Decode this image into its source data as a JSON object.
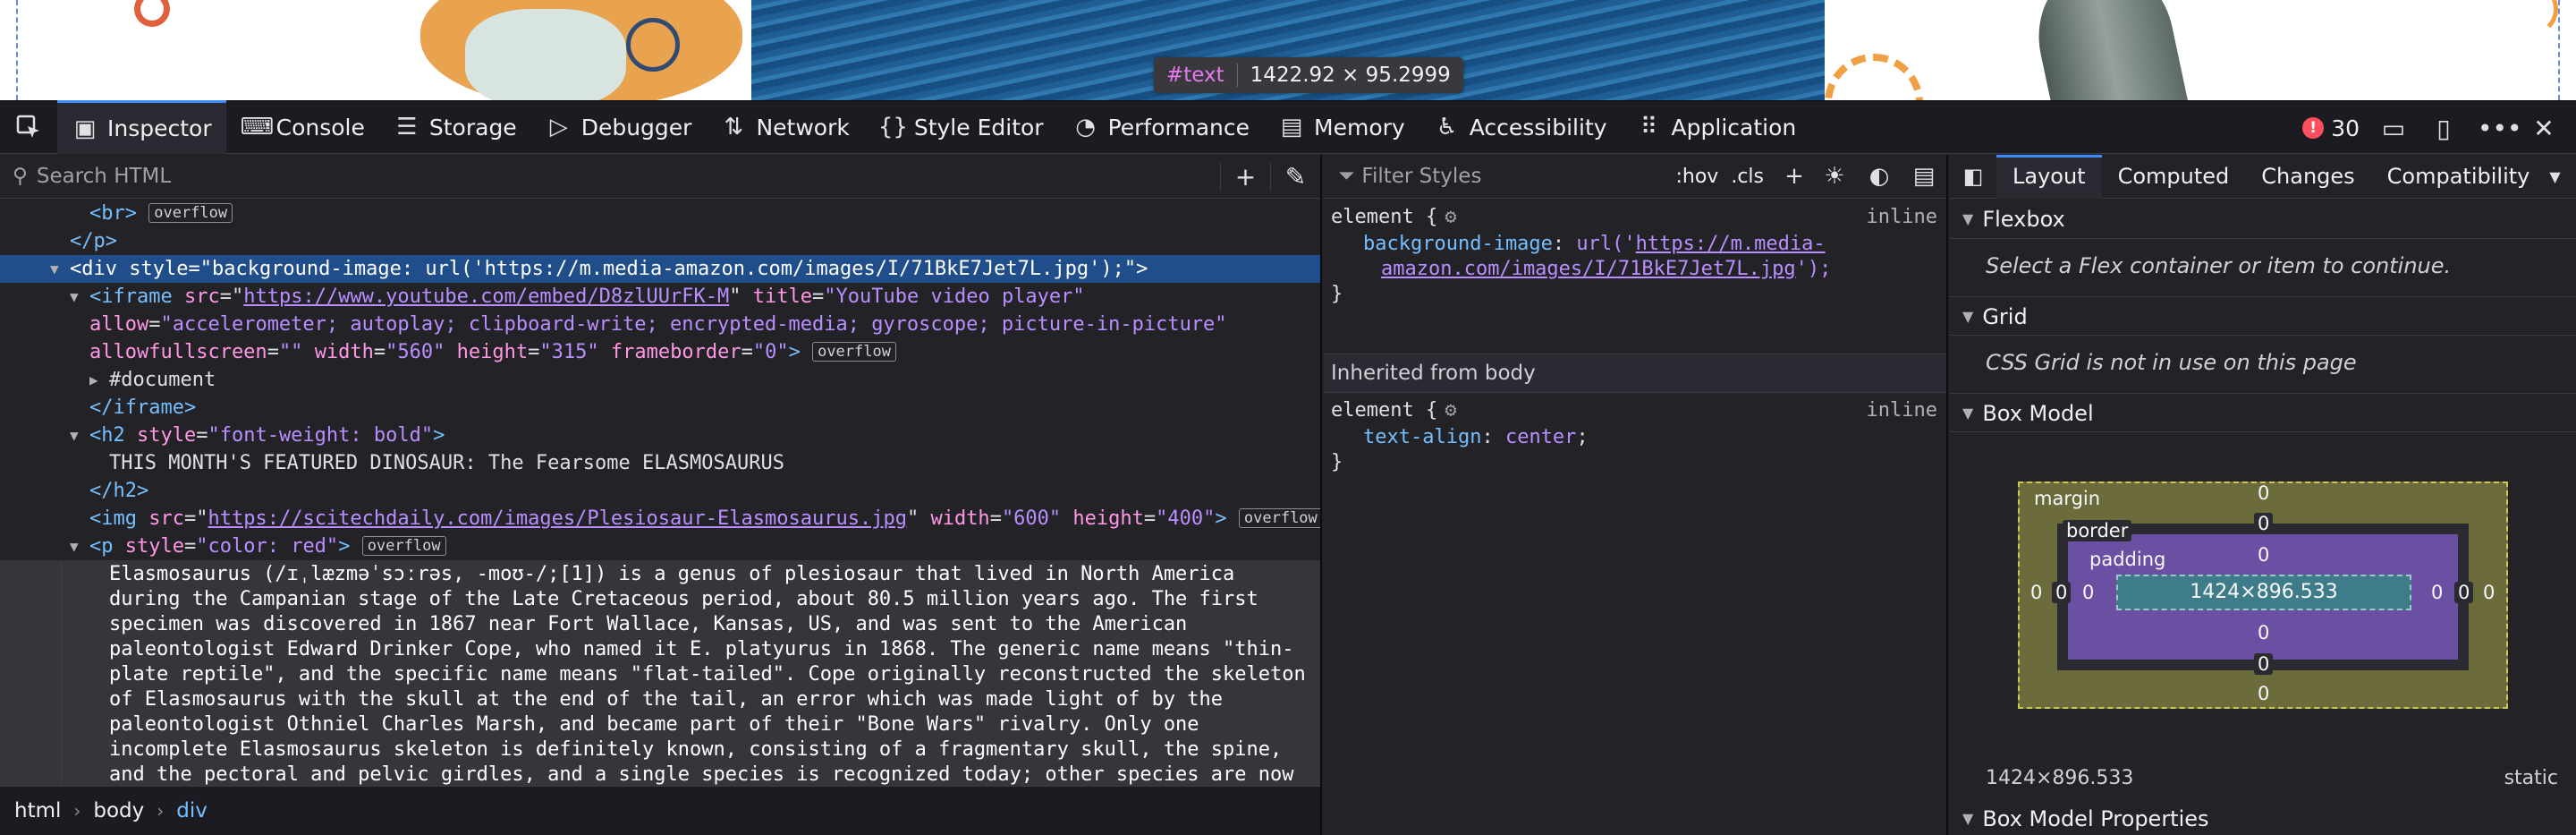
{
  "preview": {
    "tooltip_tag": "#text",
    "tooltip_dims": "1422.92 × 95.2999"
  },
  "toolbar": {
    "tabs": [
      {
        "label": "Inspector",
        "icon": "inspector-icon"
      },
      {
        "label": "Console",
        "icon": "console-icon"
      },
      {
        "label": "Storage",
        "icon": "storage-icon"
      },
      {
        "label": "Debugger",
        "icon": "debugger-icon"
      },
      {
        "label": "Network",
        "icon": "network-icon"
      },
      {
        "label": "Style Editor",
        "icon": "style-editor-icon"
      },
      {
        "label": "Performance",
        "icon": "performance-icon"
      },
      {
        "label": "Memory",
        "icon": "memory-icon"
      },
      {
        "label": "Accessibility",
        "icon": "accessibility-icon"
      },
      {
        "label": "Application",
        "icon": "application-icon"
      }
    ],
    "error_count": "30"
  },
  "markup": {
    "search_placeholder": "Search HTML",
    "lines": {
      "br_tag": "<br>",
      "overflow": "overflow",
      "p_close": "</p>",
      "div_open_a": "<div ",
      "div_style_name": "style",
      "div_style_value": "\"background-image: url('https://m.media-amazon.com/images/I/71BkE7Jet7L.jpg');\"",
      "div_open_b": ">",
      "iframe_tag": "<iframe ",
      "iframe_src_name": "src",
      "iframe_src_value": "https://www.youtube.com/embed/D8zlUUrFK-M",
      "iframe_title_name": "title",
      "iframe_title_value": "\"YouTube video player\"",
      "iframe_allow_name": "allow",
      "iframe_allow_value": "\"accelerometer; autoplay; clipboard-write; encrypted-media; gyroscope; picture-in-picture\"",
      "iframe_afs_name": "allowfullscreen",
      "iframe_afs_value": "\"\"",
      "iframe_width_name": "width",
      "iframe_width_value": "\"560\"",
      "iframe_height_name": "height",
      "iframe_height_value": "\"315\"",
      "iframe_fb_name": "frameborder",
      "iframe_fb_value": "\"0\"",
      "document": "#document",
      "iframe_close": "</iframe>",
      "h2_tag": "<h2 ",
      "h2_style_name": "style",
      "h2_style_value": "\"font-weight: bold\"",
      "h2_text": "THIS MONTH'S FEATURED DINOSAUR: The Fearsome ELASMOSAURUS",
      "h2_close": "</h2>",
      "img_tag": "<img ",
      "img_src_name": "src",
      "img_src_value": "https://scitechdaily.com/images/Plesiosaur-Elasmosaurus.jpg",
      "img_width_name": "width",
      "img_width_value": "\"600\"",
      "img_height_name": "height",
      "img_height_value": "\"400\"",
      "p_tag": "<p ",
      "p_style_name": "style",
      "p_style_value": "\"color: red\"",
      "paragraph": "Elasmosaurus (/ɪˌlæzməˈsɔːrəs, -moʊ-/;[1]) is a genus of plesiosaur that lived in North America during the Campanian stage of the Late Cretaceous period, about 80.5 million years ago. The first specimen was discovered in 1867 near Fort Wallace, Kansas, US, and was sent to the American paleontologist Edward Drinker Cope, who named it E. platyurus in 1868. The generic name means \"thin-plate reptile\", and the specific name means \"flat-tailed\". Cope originally reconstructed the skeleton of Elasmosaurus with the skull at the end of the tail, an error which was made light of by the paleontologist Othniel Charles Marsh, and became part of their \"Bone Wars\" rivalry. Only one incomplete Elasmosaurus skeleton is definitely known, consisting of a fragmentary skull, the spine, and the pectoral and pelvic girdles, and a single species is recognized today; other species are now considered invalid or have"
    },
    "breadcrumbs": [
      "html",
      "body",
      "div"
    ]
  },
  "rules": {
    "filter_placeholder": "Filter Styles",
    "hov": ":hov",
    "cls": ".cls",
    "rule1": {
      "selector": "element {",
      "source": "inline",
      "prop": "background-image",
      "val_prefix": "url('",
      "val_link_1": "https://m.media-",
      "val_link_2": "amazon.com/images/I/71BkE7Jet7L.jpg",
      "val_suffix": "');",
      "close": "}"
    },
    "inherited_header": "Inherited from body",
    "rule2": {
      "selector": "element {",
      "source": "inline",
      "prop": "text-align",
      "val": "center",
      "close": "}"
    }
  },
  "layout": {
    "tabs": [
      "Layout",
      "Computed",
      "Changes",
      "Compatibility"
    ],
    "flexbox_title": "Flexbox",
    "flexbox_msg": "Select a Flex container or item to continue.",
    "grid_title": "Grid",
    "grid_msg": "CSS Grid is not in use on this page",
    "boxmodel_title": "Box Model",
    "box": {
      "margin_label": "margin",
      "border_label": "border",
      "padding_label": "padding",
      "content": "1424×896.533",
      "margin_top": "0",
      "margin_right": "0",
      "margin_bottom": "0",
      "margin_left": "0",
      "border_top": "0",
      "border_right": "0",
      "border_bottom": "0",
      "border_left": "0",
      "padding_top": "0",
      "padding_right": "0",
      "padding_bottom": "0",
      "padding_left": "0"
    },
    "size_summary": "1424×896.533",
    "position": "static",
    "props_title": "Box Model Properties"
  }
}
